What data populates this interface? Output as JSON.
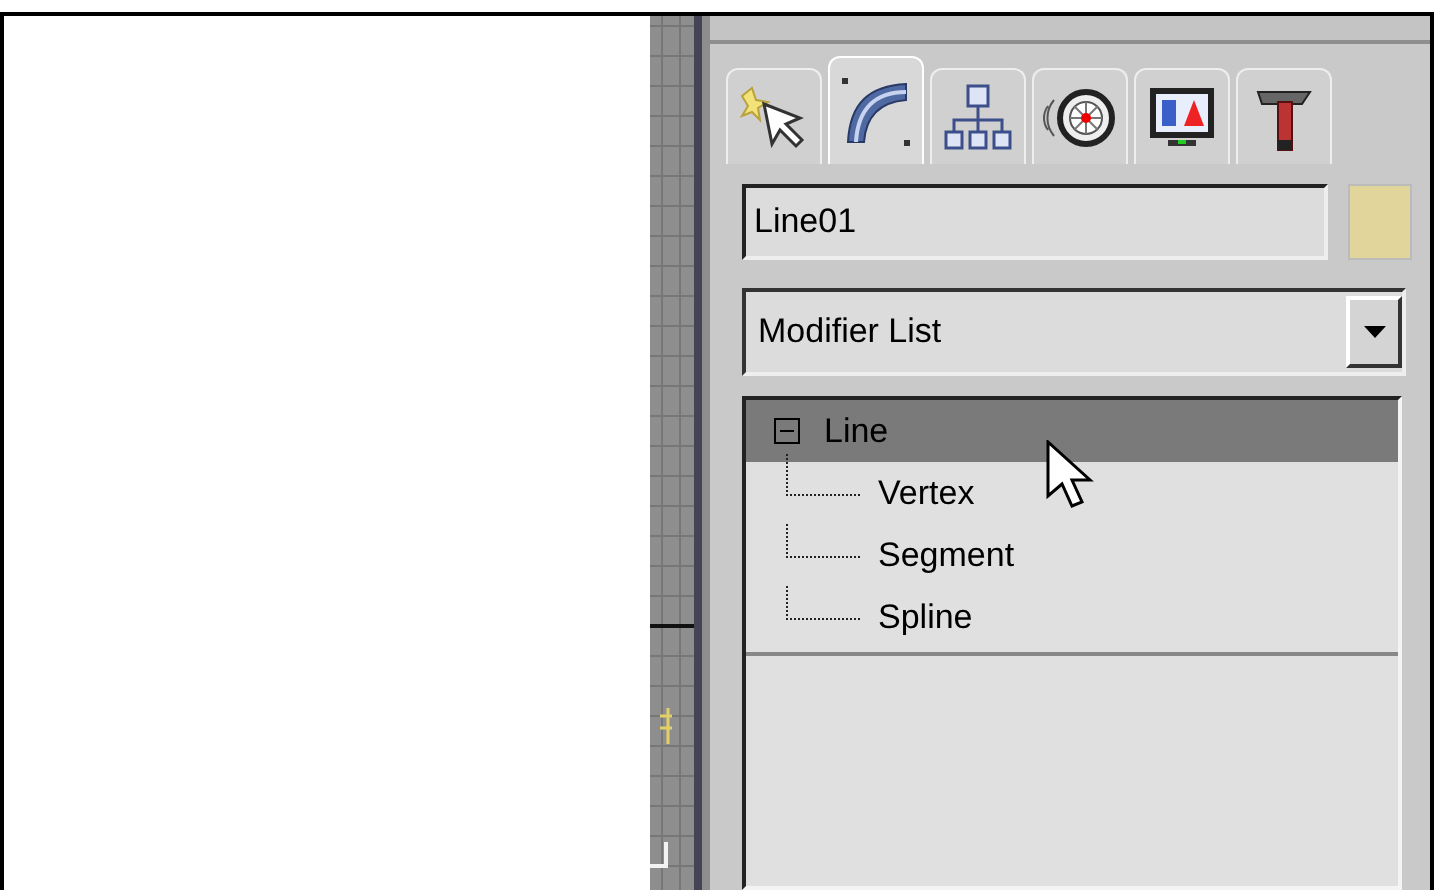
{
  "panel_tabs": [
    {
      "kind": "create",
      "selected": false
    },
    {
      "kind": "modify",
      "selected": true
    },
    {
      "kind": "hierarchy",
      "selected": false
    },
    {
      "kind": "motion",
      "selected": false
    },
    {
      "kind": "display",
      "selected": false
    },
    {
      "kind": "utilities",
      "selected": false
    }
  ],
  "object_name": {
    "value": "Line01",
    "color": "#e2d59b"
  },
  "modifier_list": {
    "value": "Modifier List"
  },
  "modifier_stack": [
    {
      "label": "Line",
      "selected": true,
      "expanded": true,
      "children": [
        {
          "label": "Vertex",
          "selected": false
        },
        {
          "label": "Segment",
          "selected": false
        },
        {
          "label": "Spline",
          "selected": false
        }
      ]
    }
  ]
}
